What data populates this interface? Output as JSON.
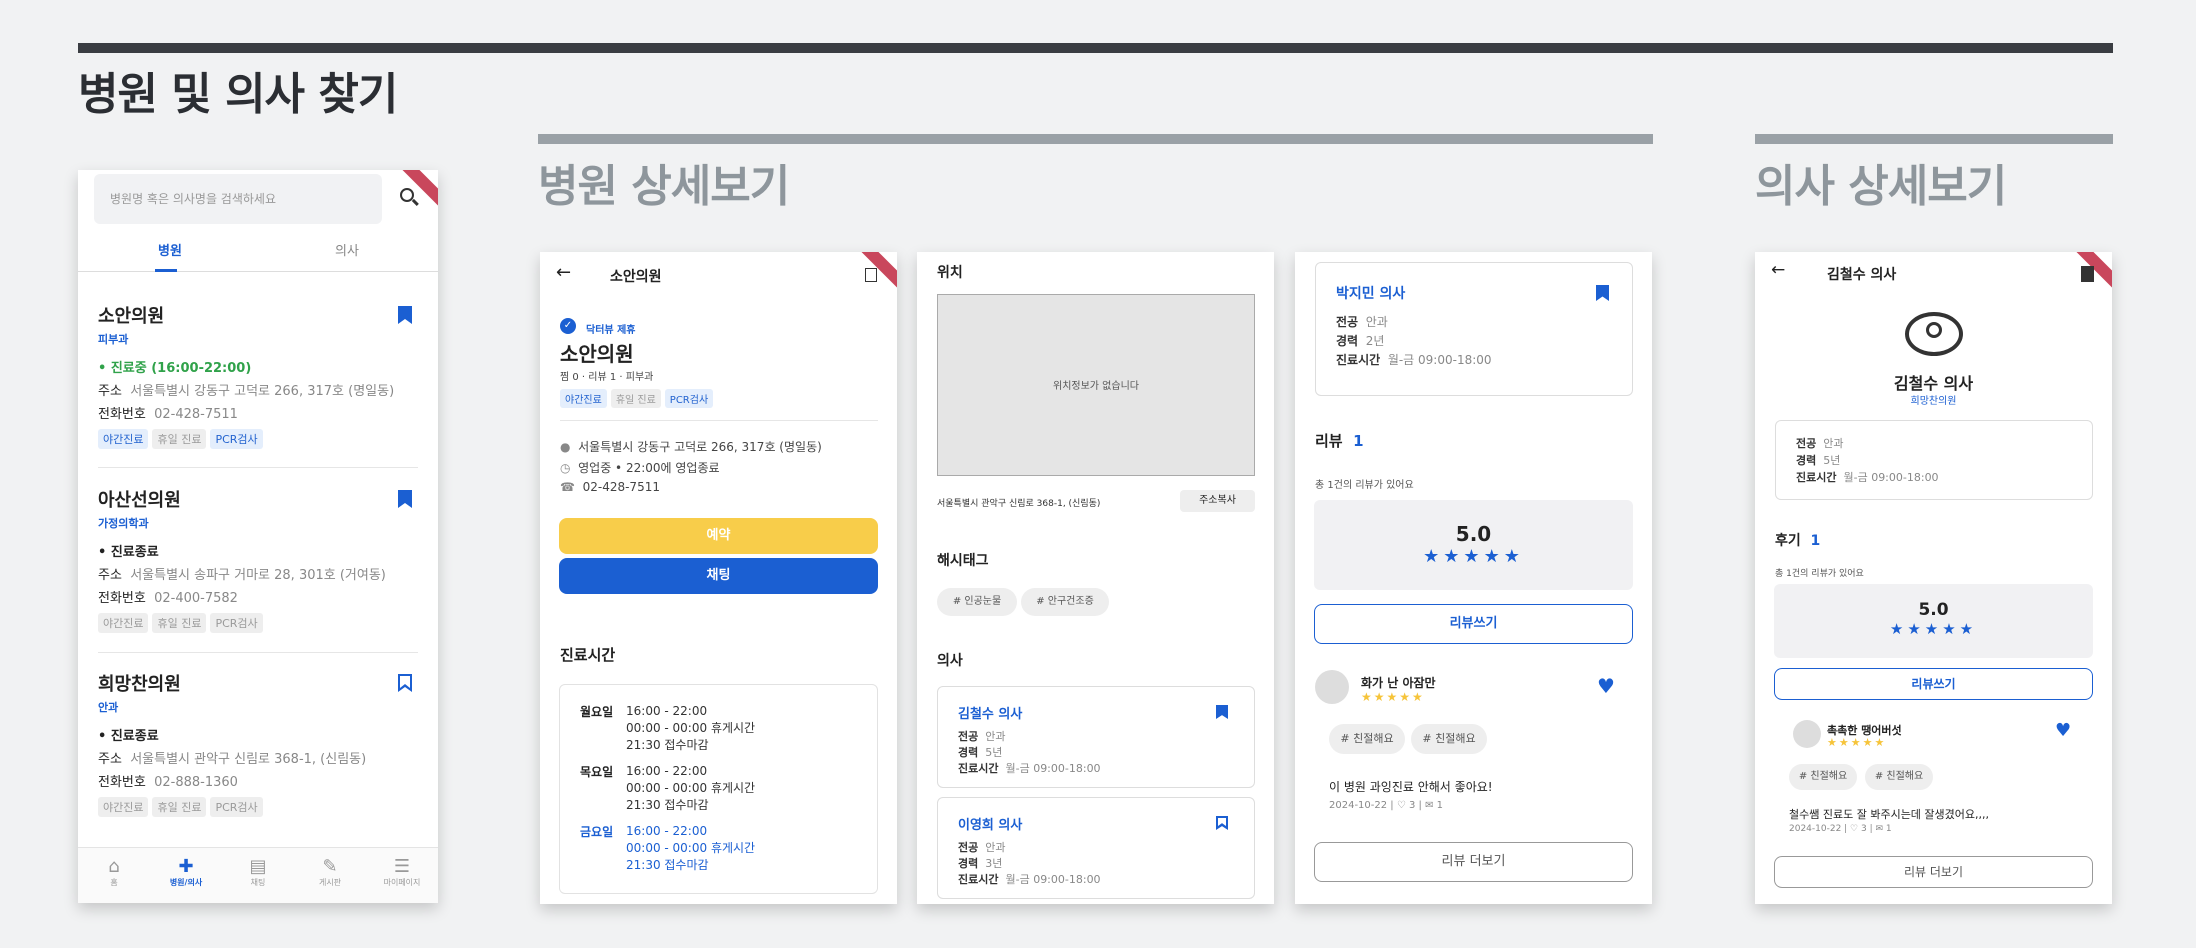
{
  "page": {
    "title": "병원 및 의사 찾기",
    "section_hospital": "병원 상세보기",
    "section_doctor": "의사 상세보기"
  },
  "search": {
    "placeholder": "병원명 혹은 의사명을 검색하세요",
    "tabs": [
      "병원",
      "의사"
    ],
    "hospitals": [
      {
        "name": "소안의원",
        "dept": "피부과",
        "status": "• 진료중 (16:00-22:00)",
        "addr_label": "주소",
        "addr": "서울특별시 강동구 고덕로 266, 317호 (명일동)",
        "phone_label": "전화번호",
        "phone": "02-428-7511",
        "tags": [
          "야간진료",
          "휴일 진료",
          "PCR검사"
        ]
      },
      {
        "name": "아산선의원",
        "dept": "가정의학과",
        "status": "• 진료종료",
        "addr_label": "주소",
        "addr": "서울특별시 송파구 거마로 28, 301호 (거여동)",
        "phone_label": "전화번호",
        "phone": "02-400-7582",
        "tags": [
          "야간진료",
          "휴일 진료",
          "PCR검사"
        ]
      },
      {
        "name": "희망찬의원",
        "dept": "안과",
        "status": "• 진료종료",
        "addr_label": "주소",
        "addr": "서울특별시 관악구 신림로 368-1, (신림동)",
        "phone_label": "전화번호",
        "phone": "02-888-1360",
        "tags": [
          "야간진료",
          "휴일 진료",
          "PCR검사"
        ]
      }
    ],
    "nav": [
      "홈",
      "병원/의사",
      "채팅",
      "게시판",
      "마이페이지"
    ]
  },
  "hospital_detail": {
    "header": "소안의원",
    "partner": "닥터뷰 제휴",
    "name": "소안의원",
    "meta": "찜 0 · 리뷰 1 · 피부과",
    "tags": [
      "야간진료",
      "휴일 진료",
      "PCR검사"
    ],
    "address": "서울특별시 강동구 고덕로 266, 317호 (명일동)",
    "open": "영업중 • 22:00에 영업종료",
    "phone": "02-428-7511",
    "reserve": "예약",
    "chat": "채팅",
    "hours_title": "진료시간",
    "hours": [
      {
        "day": "월요일",
        "lines": [
          "16:00 - 22:00",
          "00:00 - 00:00 휴게시간",
          "21:30 접수마감"
        ]
      },
      {
        "day": "목요일",
        "lines": [
          "16:00 - 22:00",
          "00:00 - 00:00 휴게시간",
          "21:30 접수마감"
        ]
      },
      {
        "day": "금요일",
        "lines": [
          "16:00 - 22:00",
          "00:00 - 00:00 휴게시간",
          "21:30 접수마감"
        ]
      }
    ]
  },
  "hospital_detail2": {
    "location_title": "위치",
    "map_empty": "위치정보가 없습니다",
    "address": "서울특별시 관악구 신림로 368-1, (신림동)",
    "copy": "주소복사",
    "hashtag_title": "해시태그",
    "hashtags": [
      "# 인공눈물",
      "# 안구건조증"
    ],
    "doctor_title": "의사",
    "doctors": [
      {
        "name": "김철수 의사",
        "major_label": "전공",
        "major": "안과",
        "career_label": "경력",
        "career": "5년",
        "time_label": "진료시간",
        "time": "월-금 09:00-18:00"
      },
      {
        "name": "이영희 의사",
        "major_label": "전공",
        "major": "안과",
        "career_label": "경력",
        "career": "3년",
        "time_label": "진료시간",
        "time": "월-금 09:00-18:00"
      }
    ]
  },
  "hospital_detail3": {
    "doctor": {
      "name": "박지민 의사",
      "major_label": "전공",
      "major": "안과",
      "career_label": "경력",
      "career": "2년",
      "time_label": "진료시간",
      "time": "월-금 09:00-18:00"
    },
    "review_title": "리뷰",
    "review_count": "1",
    "review_total": "총 1건의 리뷰가 있어요",
    "score": "5.0",
    "write": "리뷰쓰기",
    "review": {
      "author": "화가 난 아잠만",
      "tags": [
        "# 친절해요",
        "# 친절해요"
      ],
      "text": "이 병원 과잉진료 안해서 좋아요!",
      "meta": "2024-10-22 | ♡ 3 | ✉ 1"
    },
    "more": "리뷰 더보기"
  },
  "doctor_detail": {
    "header": "김철수 의사",
    "name": "김철수 의사",
    "hospital": "희망찬의원",
    "major_label": "전공",
    "major": "안과",
    "career_label": "경력",
    "career": "5년",
    "time_label": "진료시간",
    "time": "월-금 09:00-18:00",
    "review_title": "후기",
    "review_count": "1",
    "review_total": "총 1건의 리뷰가 있어요",
    "score": "5.0",
    "write": "리뷰쓰기",
    "review": {
      "author": "촉촉한 땡어버섯",
      "tags": [
        "# 친절해요",
        "# 친절해요"
      ],
      "text": "철수쌤 진료도 잘 봐주시는데 잘생겼어요,,,,",
      "meta": "2024-10-22 | ♡ 3 | ✉ 1"
    },
    "more": "리뷰 더보기"
  },
  "colors": {
    "accent": "#1b5fd2",
    "yellow": "#f8cd4a",
    "green": "#30a24a",
    "bar_dark": "#3a3d42",
    "bar_gray": "#9aa1a6"
  }
}
